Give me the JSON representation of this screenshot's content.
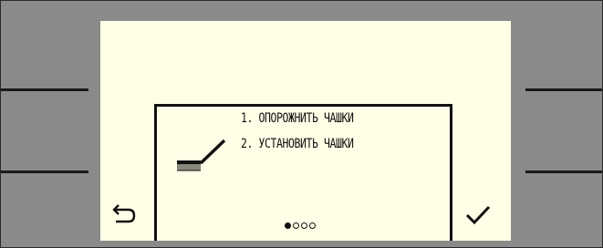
{
  "dialog": {
    "instructions": [
      "1. ОПОРОЖНИТЬ ЧАШКИ",
      "2. УСТАНОВИТЬ ЧАШКИ"
    ],
    "illustration_icon": "brush-icon"
  },
  "pagination": {
    "total": 4,
    "current": 1
  },
  "soft_keys": {
    "left_icon": "back-arrow-icon",
    "right_icon": "checkmark-icon"
  },
  "colors": {
    "screen_background": "#fffee6",
    "bezel": "#8a8a8a",
    "ink": "#111111"
  }
}
